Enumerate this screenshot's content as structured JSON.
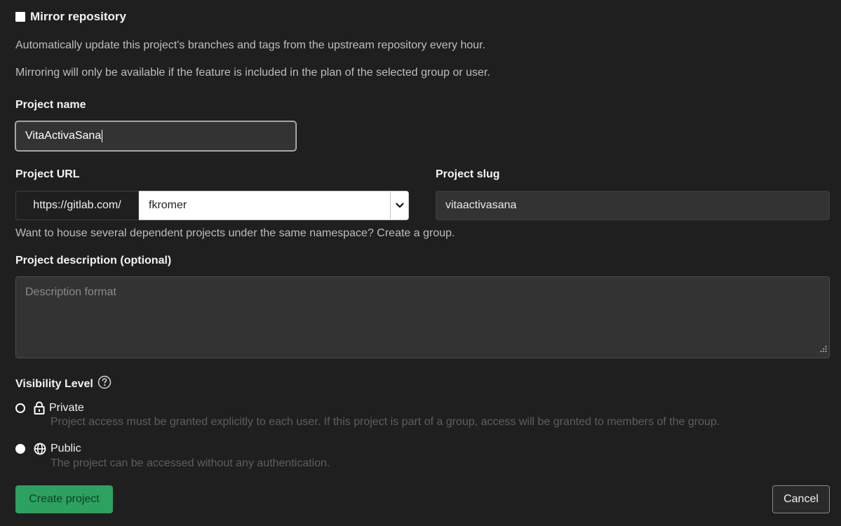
{
  "mirror": {
    "label": "Mirror repository",
    "help_1": "Automatically update this project's branches and tags from the upstream repository every hour.",
    "help_2": "Mirroring will only be available if the feature is included in the plan of the selected group or user.",
    "checked": true
  },
  "project_name": {
    "label": "Project name",
    "value": "VitaActivaSana"
  },
  "project_url": {
    "label": "Project URL",
    "prefix": "https://gitlab.com/",
    "namespace": "fkromer"
  },
  "project_slug": {
    "label": "Project slug",
    "value": "vitaactivasana"
  },
  "group_hint": "Want to house several dependent projects under the same namespace? Create a group.",
  "description": {
    "label": "Project description (optional)",
    "placeholder": "Description format"
  },
  "visibility": {
    "label": "Visibility Level",
    "help_icon": "question-circle-icon",
    "options": [
      {
        "label": "Private",
        "icon": "lock-icon",
        "help": "Project access must be granted explicitly to each user. If this project is part of a group, access will be granted to members of the group.",
        "selected": false
      },
      {
        "label": "Public",
        "icon": "globe-icon",
        "help": "The project can be accessed without any authentication.",
        "selected": true
      }
    ]
  },
  "actions": {
    "create_label": "Create project",
    "cancel_label": "Cancel"
  },
  "colors": {
    "background": "#1f1f1f",
    "input_bg": "#333333",
    "primary_green": "#2da160"
  }
}
